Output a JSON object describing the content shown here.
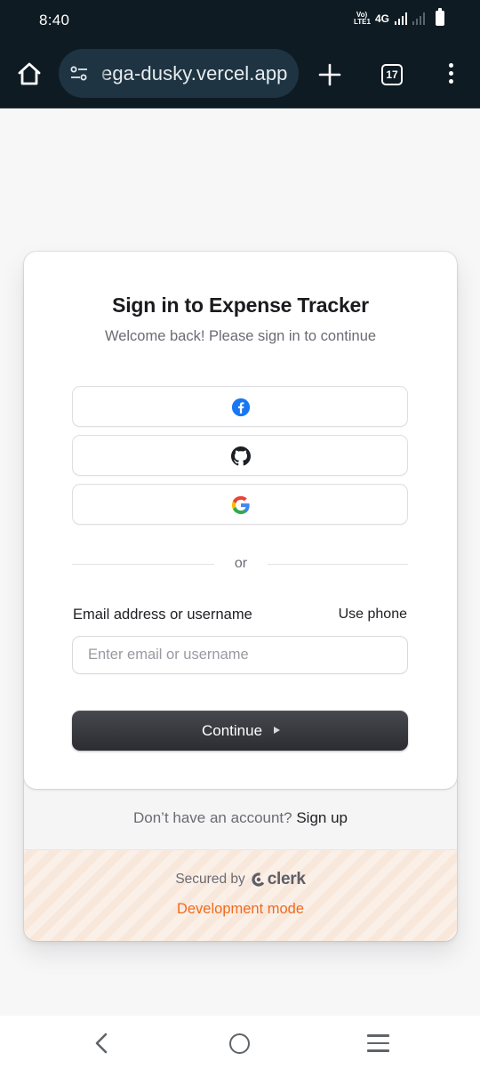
{
  "status_bar": {
    "time": "8:40",
    "volte": "VoLTE",
    "network": "4G",
    "battery_fill": 1.0
  },
  "browser": {
    "url": "ega-dusky.vercel.app",
    "tab_count": "17",
    "icons": [
      "home-icon",
      "site-settings-icon",
      "new-tab-icon",
      "tab-switcher-icon",
      "more-menu-icon"
    ]
  },
  "signin": {
    "title": "Sign in to Expense Tracker",
    "subtitle": "Welcome back! Please sign in to continue",
    "social_providers": [
      "facebook",
      "github",
      "google"
    ],
    "divider_text": "or",
    "email_label": "Email address or username",
    "use_phone": "Use phone",
    "email_placeholder": "Enter email or username",
    "email_value": "",
    "continue_label": "Continue",
    "no_account_text": "Don’t have an account?",
    "signup_link": "Sign up",
    "secured_by": "Secured by",
    "clerk_brand": "clerk",
    "dev_mode": "Development mode",
    "accent_color": "#f06a1d",
    "button_color": "#2f2f35"
  },
  "navigation": {
    "icons": [
      "back-icon",
      "home-circle-icon",
      "recent-apps-icon"
    ]
  }
}
